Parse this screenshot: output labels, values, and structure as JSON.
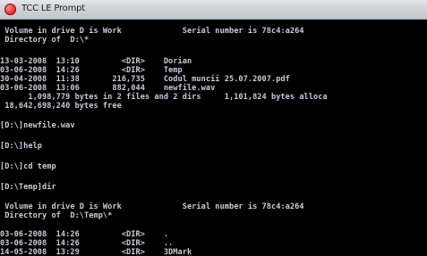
{
  "window": {
    "title": "TCC LE Prompt",
    "icon": "tcc-app-icon"
  },
  "console": {
    "lines": [
      " Volume in drive D is Work             Serial number is 78c4:a264",
      " Directory of  D:\\*",
      "",
      "13-03-2008  13:10         <DIR>    Dorian",
      "03-06-2008  14:26         <DIR>    Temp",
      "30-04-2008  11:38       216,735    Codul muncii 25.07.2007.pdf",
      "03-06-2008  13:06       882,044    newfile.wav",
      "      1,098,779 bytes in 2 files and 2 dirs     1,101,824 bytes alloca",
      " 18,642,698,240 bytes free",
      "",
      "[D:\\]newfile.wav",
      "",
      "[D:\\]help",
      "",
      "[D:\\]cd temp",
      "",
      "[D:\\Temp]dir",
      "",
      " Volume in drive D is Work             Serial number is 78c4:a264",
      " Directory of  D:\\Temp\\*",
      "",
      "03-06-2008  14:26         <DIR>    .",
      "03-06-2008  14:26         <DIR>    ..",
      "14-05-2008  13:29         <DIR>    3DMark"
    ]
  }
}
